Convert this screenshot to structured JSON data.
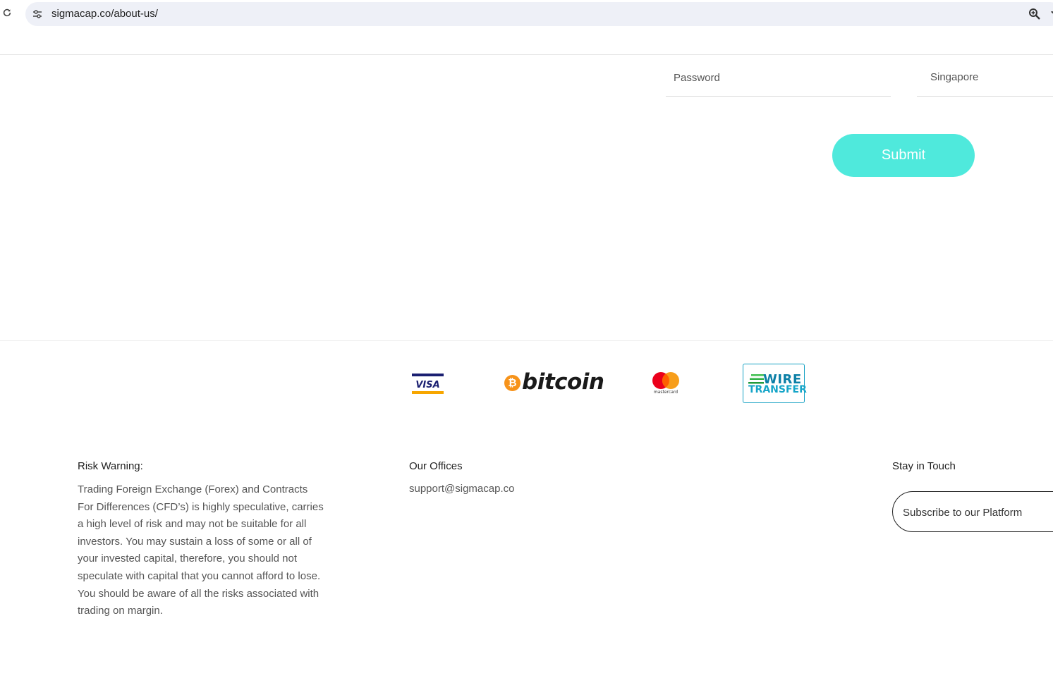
{
  "browser": {
    "url": "sigmacap.co/about-us/"
  },
  "form": {
    "password_placeholder": "Password",
    "country_value": "Singapore",
    "submit_label": "Submit"
  },
  "payments": {
    "visa": "VISA",
    "bitcoin_symbol": "₿",
    "bitcoin": "bitcoin",
    "mastercard": "mastercard",
    "wire_line1": "WIRE",
    "wire_line2": "TRANSFER"
  },
  "footer": {
    "risk_heading": "Risk Warning:",
    "risk_text": "Trading Foreign Exchange (Forex) and Contracts For Differences (CFD’s) is highly speculative, carries a high level of risk and may not be suitable for all investors. You may sustain a loss of some or all of your invested capital, therefore, you should not speculate with capital that you cannot afford to lose. You should be aware of all the risks associated with trading on margin.",
    "offices_heading": "Our Offices",
    "support_email": "support@sigmacap.co",
    "touch_heading": "Stay in Touch",
    "subscribe_placeholder": "Subscribe to our Platform"
  },
  "colors": {
    "accent": "#4fe9dc",
    "omnibox_bg": "#eef0f7",
    "bitcoin": "#f7931a",
    "mastercard_red": "#eb001b",
    "mastercard_yellow": "#f79e1b",
    "visa_blue": "#1a1f71",
    "visa_gold": "#f7a600"
  },
  "icons": [
    "reload-icon",
    "site-info-icon",
    "zoom-icon",
    "star-icon"
  ]
}
